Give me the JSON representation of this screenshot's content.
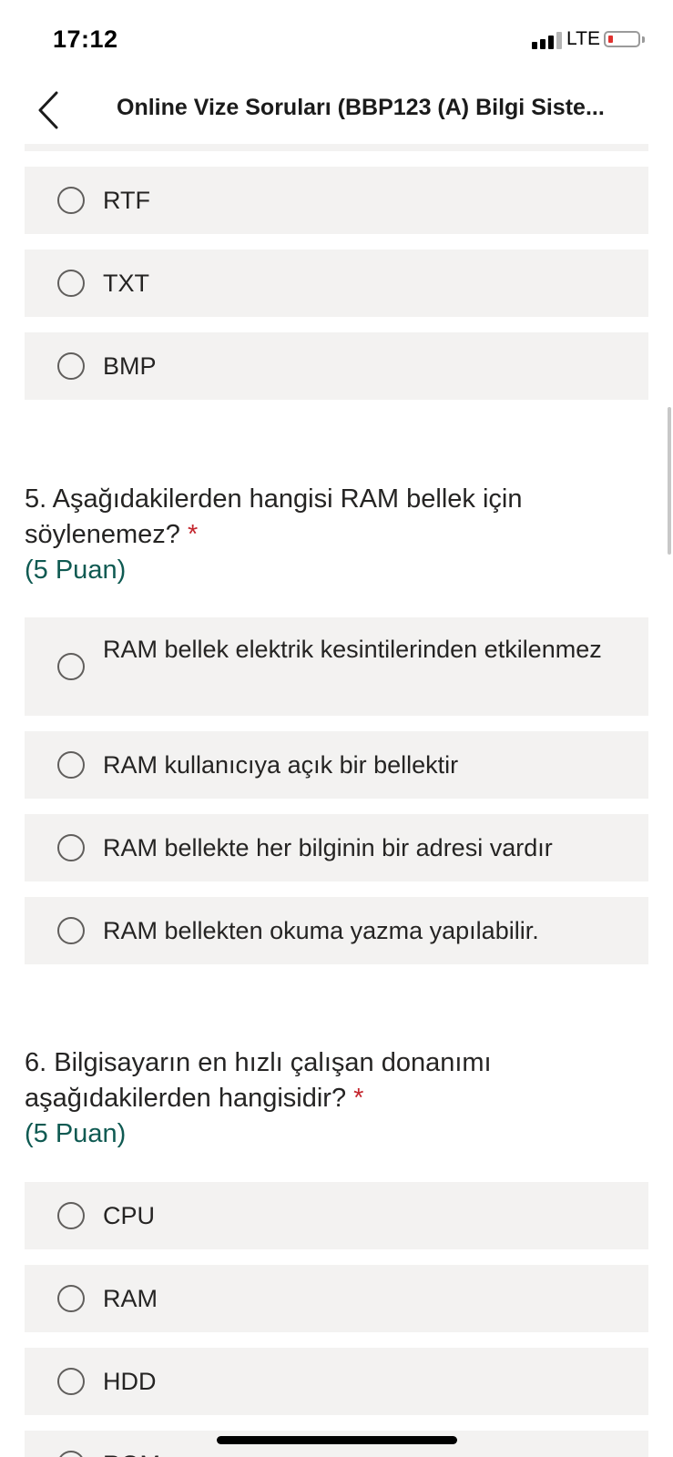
{
  "status_bar": {
    "time": "17:12",
    "network": "LTE",
    "signal_icon": "signal-bars-icon",
    "battery_icon": "battery-low-icon",
    "battery_color": "#e0322f"
  },
  "nav": {
    "back_icon": "chevron-left-icon",
    "title": "Online Vize Soruları (BBP123 (A) Bilgi Siste..."
  },
  "colors": {
    "option_bg": "#f3f2f1",
    "required": "#c4262e",
    "points": "#0f5a52"
  },
  "q4_options": [
    "RTF",
    "TXT",
    "BMP"
  ],
  "q5": {
    "text": "5. Aşağıdakilerden hangisi RAM bellek için söylenemez?",
    "required_mark": "*",
    "points": "(5 Puan)",
    "options": [
      "RAM bellek elektrik kesintilerinden etkilenmez",
      "RAM kullanıcıya açık bir bellektir",
      "RAM bellekte her bilginin bir adresi vardır",
      "RAM bellekten okuma yazma yapılabilir."
    ]
  },
  "q6": {
    "text": "6. Bilgisayarın en hızlı çalışan donanımı aşağıdakilerden hangisidir?",
    "required_mark": "*",
    "points": "(5 Puan)",
    "options": [
      "CPU",
      "RAM",
      "HDD",
      "ROM"
    ]
  }
}
